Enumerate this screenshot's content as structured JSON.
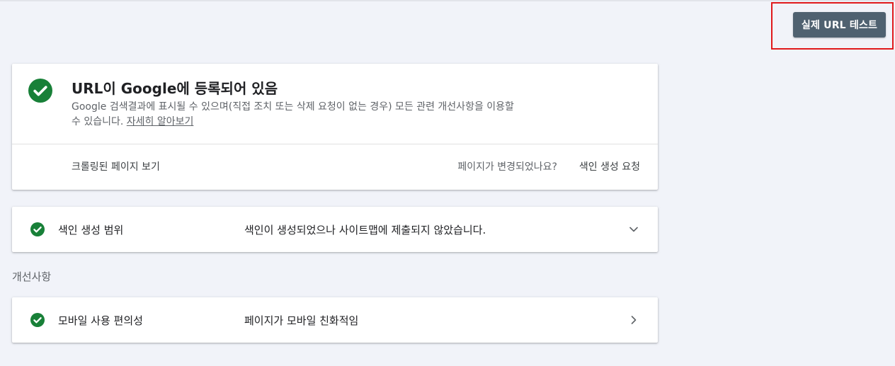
{
  "header": {
    "live_test_button": "실제 URL 테스트"
  },
  "status_card": {
    "title": "URL이 Google에 등록되어 있음",
    "description": "Google 검색결과에 표시될 수 있으며(직접 조치 또는 삭제 요청이 없는 경우) 모든 관련 개선사항을 이용할 수 있습니다.",
    "learn_more": "자세히 알아보기",
    "view_crawled_page": "크롤링된 페이지 보기",
    "page_changed_question": "페이지가 변경되었나요?",
    "request_indexing": "색인 생성 요청",
    "icon": "check-circle-icon",
    "status_color": "#188038"
  },
  "coverage": {
    "label": "색인 생성 범위",
    "status": "색인이 생성되었으나 사이트맵에 제출되지 않았습니다.",
    "icon": "check-circle-icon",
    "arrow_icon": "chevron-down-icon"
  },
  "enhancements": {
    "heading": "개선사항",
    "items": [
      {
        "label": "모바일 사용 편의성",
        "status": "페이지가 모바일 친화적임",
        "icon": "check-circle-icon",
        "arrow_icon": "chevron-right-icon"
      }
    ]
  },
  "highlight_color": "#e0191b",
  "button_color": "#4f6170"
}
